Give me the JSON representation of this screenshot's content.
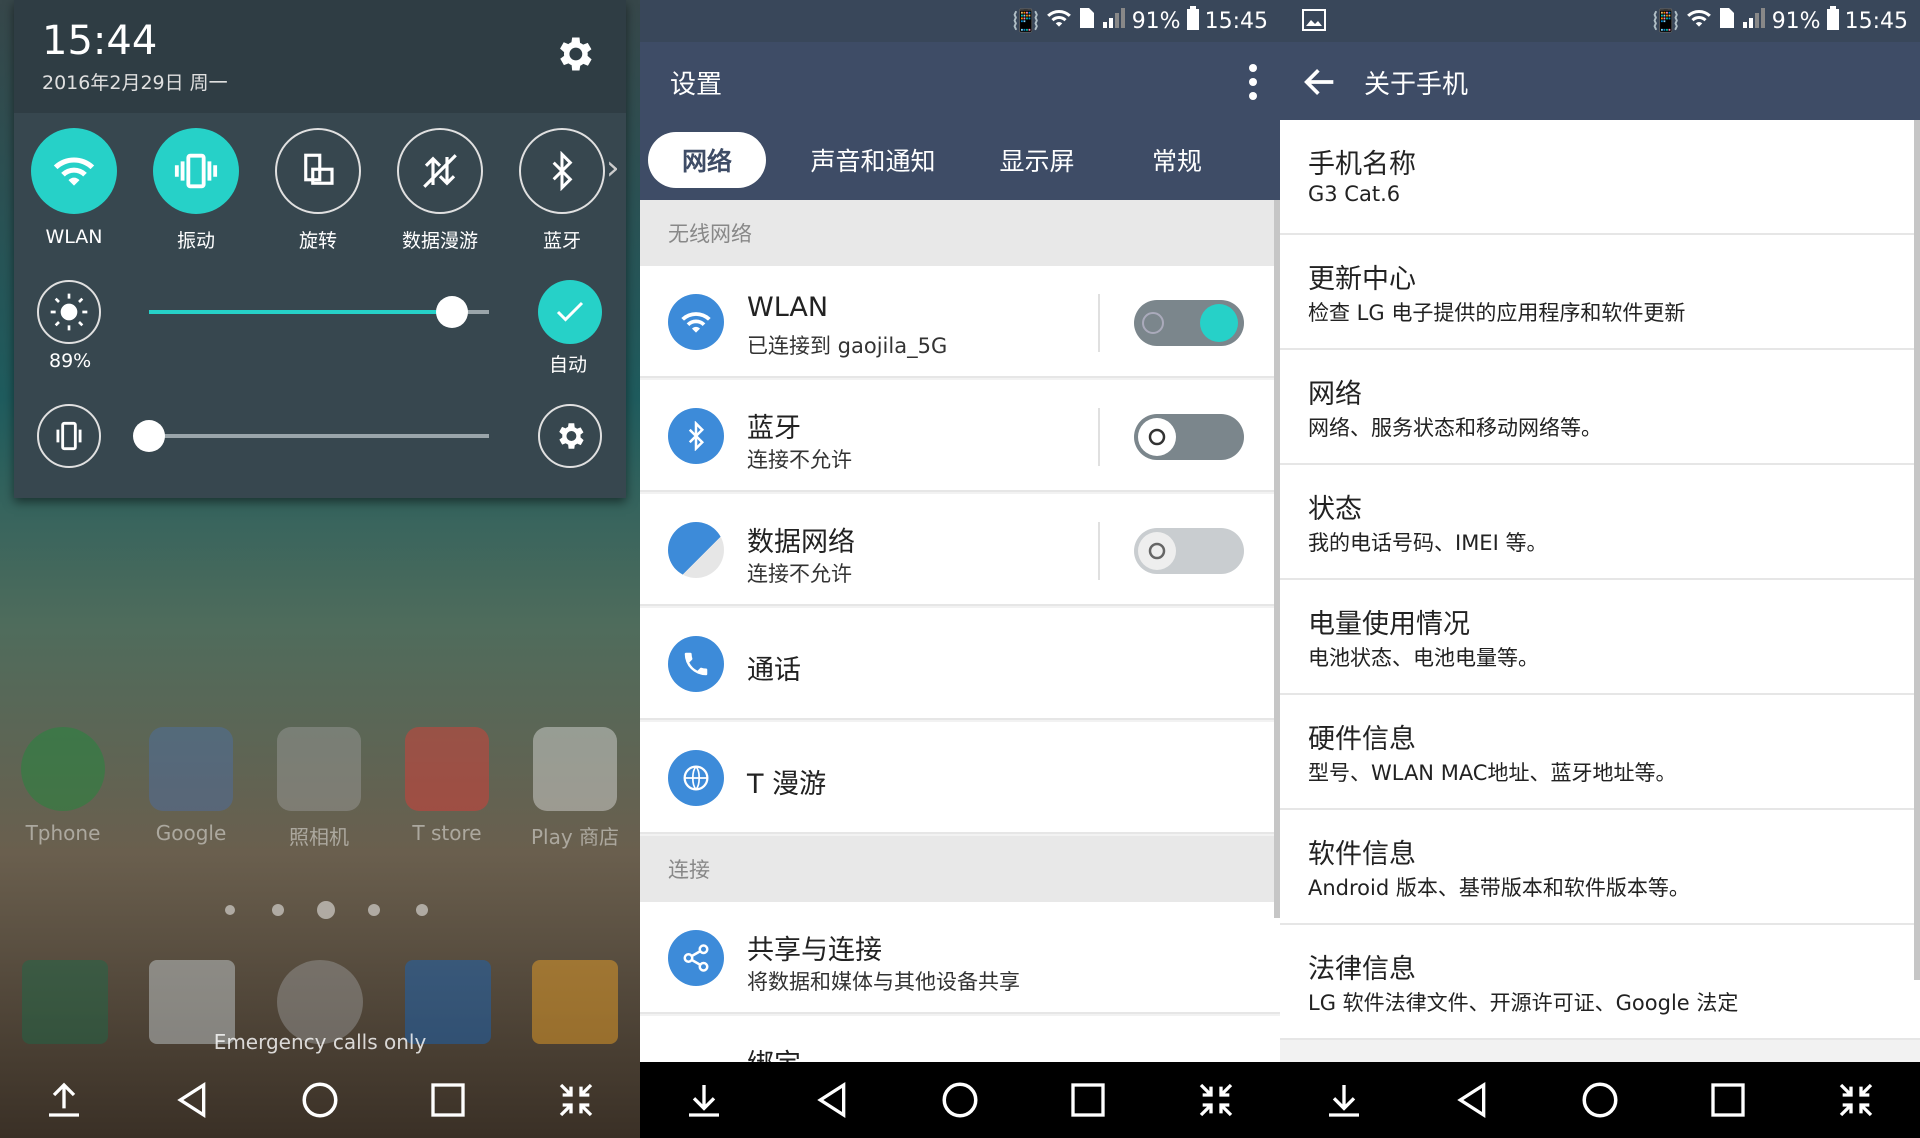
{
  "panel1": {
    "clock": "15:44",
    "date": "2016年2月29日 周一",
    "tiles": [
      {
        "label": "WLAN",
        "icon": "wifi-icon",
        "on": true
      },
      {
        "label": "振动",
        "icon": "vibrate-icon",
        "on": true
      },
      {
        "label": "旋转",
        "icon": "rotate-icon",
        "on": false
      },
      {
        "label": "数据漫游",
        "icon": "data-roaming-icon",
        "on": false
      },
      {
        "label": "蓝牙",
        "icon": "bluetooth-icon",
        "on": false
      }
    ],
    "brightness_percent": "89%",
    "brightness_level": 0.89,
    "auto_label": "自动",
    "volume_level": 0.0,
    "home_apps": [
      "Tphone",
      "Google",
      "照相机",
      "T store",
      "Play 商店"
    ],
    "emergency": "Emergency calls only"
  },
  "panel2": {
    "status": {
      "battery": "91%",
      "time": "15:45"
    },
    "title": "设置",
    "tabs": [
      "网络",
      "声音和通知",
      "显示屏",
      "常规"
    ],
    "section_wireless": "无线网络",
    "rows": [
      {
        "title": "WLAN",
        "sub": "已连接到 gaojila_5G",
        "icon": "wifi-icon",
        "toggle": "on"
      },
      {
        "title": "蓝牙",
        "sub": "连接不允许",
        "icon": "bluetooth-icon",
        "toggle": "off"
      },
      {
        "title": "数据网络",
        "sub": "连接不允许",
        "icon": "data-network-icon",
        "toggle": "disabled"
      },
      {
        "title": "通话",
        "icon": "phone-icon"
      },
      {
        "title": "T 漫游",
        "icon": "t-roaming-icon"
      }
    ],
    "section_connect": "连接",
    "share": {
      "title": "共享与连接",
      "sub": "将数据和媒体与其他设备共享"
    },
    "partial": "绑定"
  },
  "panel3": {
    "status": {
      "battery": "91%",
      "time": "15:45"
    },
    "title": "关于手机",
    "items": [
      {
        "title": "手机名称",
        "sub": "G3 Cat.6"
      },
      {
        "title": "更新中心",
        "sub": "检查 LG 电子提供的应用程序和软件更新"
      },
      {
        "title": "网络",
        "sub": "网络、服务状态和移动网络等。"
      },
      {
        "title": "状态",
        "sub": "我的电话号码、IMEI 等。"
      },
      {
        "title": "电量使用情况",
        "sub": "电池状态、电池电量等。"
      },
      {
        "title": "硬件信息",
        "sub": "型号、WLAN MAC地址、蓝牙地址等。"
      },
      {
        "title": "软件信息",
        "sub": "Android 版本、基带版本和软件版本等。"
      },
      {
        "title": "法律信息",
        "sub": "LG 软件法律文件、开源许可证、Google 法定"
      }
    ]
  }
}
